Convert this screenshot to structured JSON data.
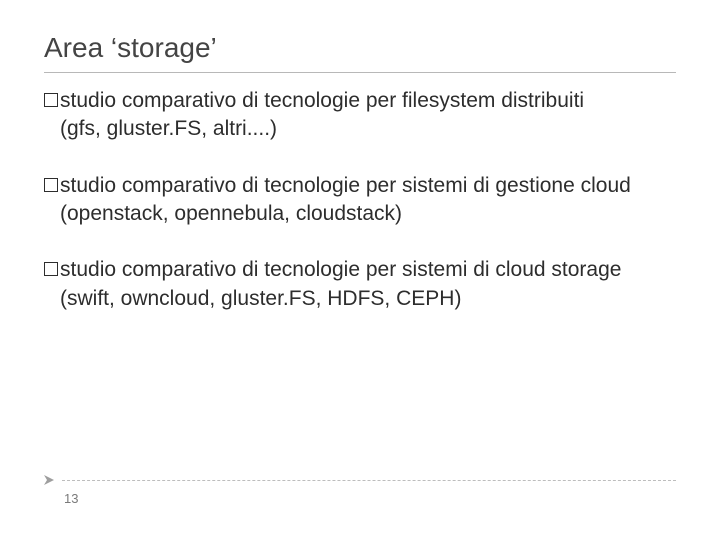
{
  "title": "Area ‘storage’",
  "bullets": [
    {
      "gap": "",
      "text": "studio comparativo di tecnologie per filesystem distribuiti\n(gfs, gluster.FS, altri....)"
    },
    {
      "gap": " ",
      "text": "studio comparativo di tecnologie per sistemi di gestione cloud  (openstack, opennebula, cloudstack)"
    },
    {
      "gap": " ",
      "text": "studio comparativo di tecnologie per sistemi di cloud storage\n(swift, owncloud, gluster.FS, HDFS, CEPH)"
    }
  ],
  "page_number": "13"
}
